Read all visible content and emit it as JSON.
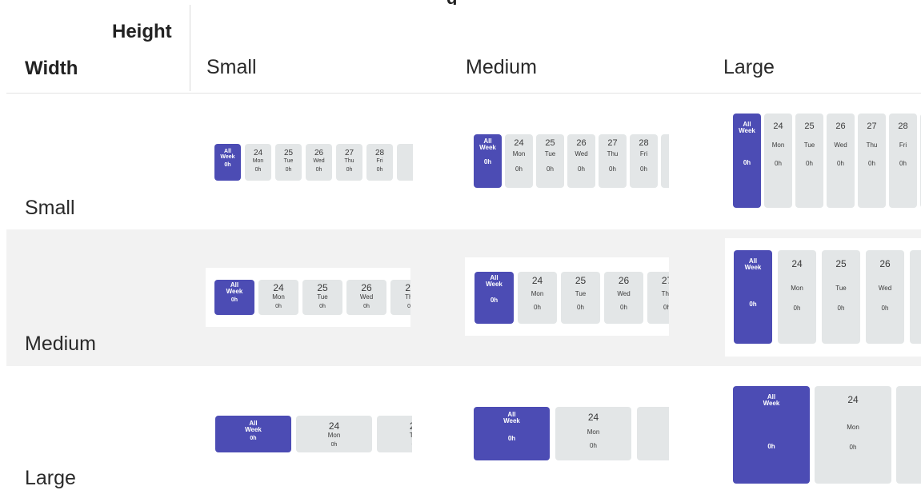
{
  "header": {
    "height_label": "Height",
    "width_label": "Width",
    "top_cutoff_text": "g",
    "columns": [
      "Small",
      "Medium",
      "Large"
    ]
  },
  "rows": [
    "Small",
    "Medium",
    "Large"
  ],
  "widget": {
    "all_week": {
      "line1": "All",
      "line2": "Week",
      "hours": "0h"
    },
    "days": [
      {
        "date": "24",
        "day": "Mon",
        "hours": "0h"
      },
      {
        "date": "25",
        "day": "Tue",
        "hours": "0h"
      },
      {
        "date": "26",
        "day": "Wed",
        "hours": "0h"
      },
      {
        "date": "27",
        "day": "Thu",
        "hours": "0h"
      },
      {
        "date": "28",
        "day": "Fri",
        "hours": "0h"
      }
    ]
  },
  "colors": {
    "accent": "#4c4cb4",
    "tile": "#e3e6e7",
    "row_band": "#f2f2f2",
    "divider": "#e3e3e3"
  }
}
